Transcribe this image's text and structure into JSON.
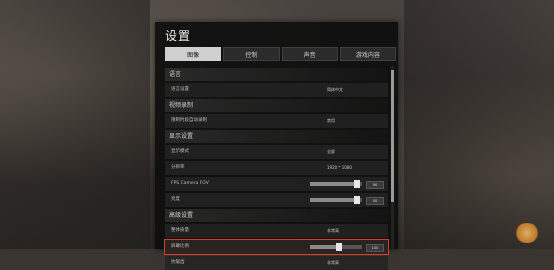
{
  "panel": {
    "title": "设置",
    "tabs": [
      {
        "label": "图像",
        "active": true
      },
      {
        "label": "控制",
        "active": false
      },
      {
        "label": "声音",
        "active": false
      },
      {
        "label": "游戏内容",
        "active": false
      }
    ]
  },
  "sections": [
    {
      "title": "语言",
      "rows": [
        {
          "label": "语言设置",
          "value": "简体中文"
        }
      ]
    },
    {
      "title": "视频录制",
      "rows": [
        {
          "label": "限制时段自动录制",
          "value": "禁用"
        }
      ]
    },
    {
      "title": "显示设置",
      "rows": [
        {
          "label": "显示模式",
          "value": "全屏"
        },
        {
          "label": "分辨率",
          "value": "1920 * 1080"
        },
        {
          "label": "FPS Camera FOV",
          "slider": 0.9,
          "number": "90"
        },
        {
          "label": "亮度",
          "slider": 0.9,
          "number": "50"
        }
      ]
    },
    {
      "title": "高级设置",
      "rows": [
        {
          "label": "整体质量",
          "value": "非常高"
        },
        {
          "label": "屏幕比例",
          "slider": 0.55,
          "number": "100",
          "highlight": true
        },
        {
          "label": "抗锯齿",
          "value": "非常高"
        }
      ]
    }
  ],
  "scrollbar": {
    "position": 0.1
  },
  "colors": {
    "highlight": "#d63b2e",
    "panel_bg": "#0e0e0e",
    "active_tab": "#cfcfcf"
  }
}
